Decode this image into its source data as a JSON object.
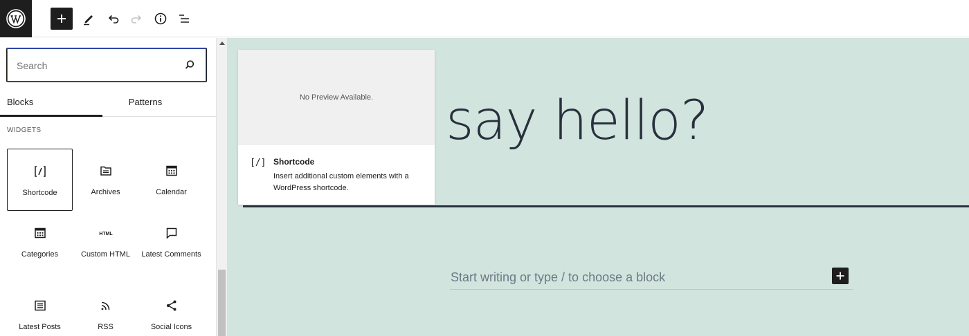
{
  "toolbar": {
    "logo_icon": "wordpress-logo-icon",
    "add_icon": "plus-icon",
    "tools_icon": "pencil-icon",
    "undo_icon": "undo-icon",
    "redo_icon": "redo-icon",
    "info_icon": "info-icon",
    "outline_icon": "list-view-icon"
  },
  "inserter": {
    "search_value": "Search",
    "tabs": [
      {
        "label": "Blocks",
        "active": true
      },
      {
        "label": "Patterns",
        "active": false
      }
    ],
    "category_title": "WIDGETS",
    "blocks": [
      {
        "label": "Shortcode",
        "icon": "shortcode-icon",
        "selected": true
      },
      {
        "label": "Archives",
        "icon": "folder-icon",
        "selected": false
      },
      {
        "label": "Calendar",
        "icon": "calendar-icon",
        "selected": false
      },
      {
        "label": "Categories",
        "icon": "categories-icon",
        "selected": false
      },
      {
        "label": "Custom HTML",
        "icon": "html-icon",
        "selected": false
      },
      {
        "label": "Latest Comments",
        "icon": "comment-icon",
        "selected": false
      },
      {
        "label": "Latest Posts",
        "icon": "post-list-icon",
        "selected": false
      },
      {
        "label": "RSS",
        "icon": "rss-icon",
        "selected": false
      },
      {
        "label": "Social Icons",
        "icon": "share-icon",
        "selected": false
      }
    ]
  },
  "preview": {
    "empty_text": "No Preview Available.",
    "block_icon_text": "[/]",
    "title": "Shortcode",
    "description": "Insert additional custom elements with a WordPress shortcode."
  },
  "canvas": {
    "heading": "say hello?",
    "placeholder": "Start writing or type / to choose a block",
    "background": "#d1e4dd",
    "text_color": "#28303d"
  }
}
